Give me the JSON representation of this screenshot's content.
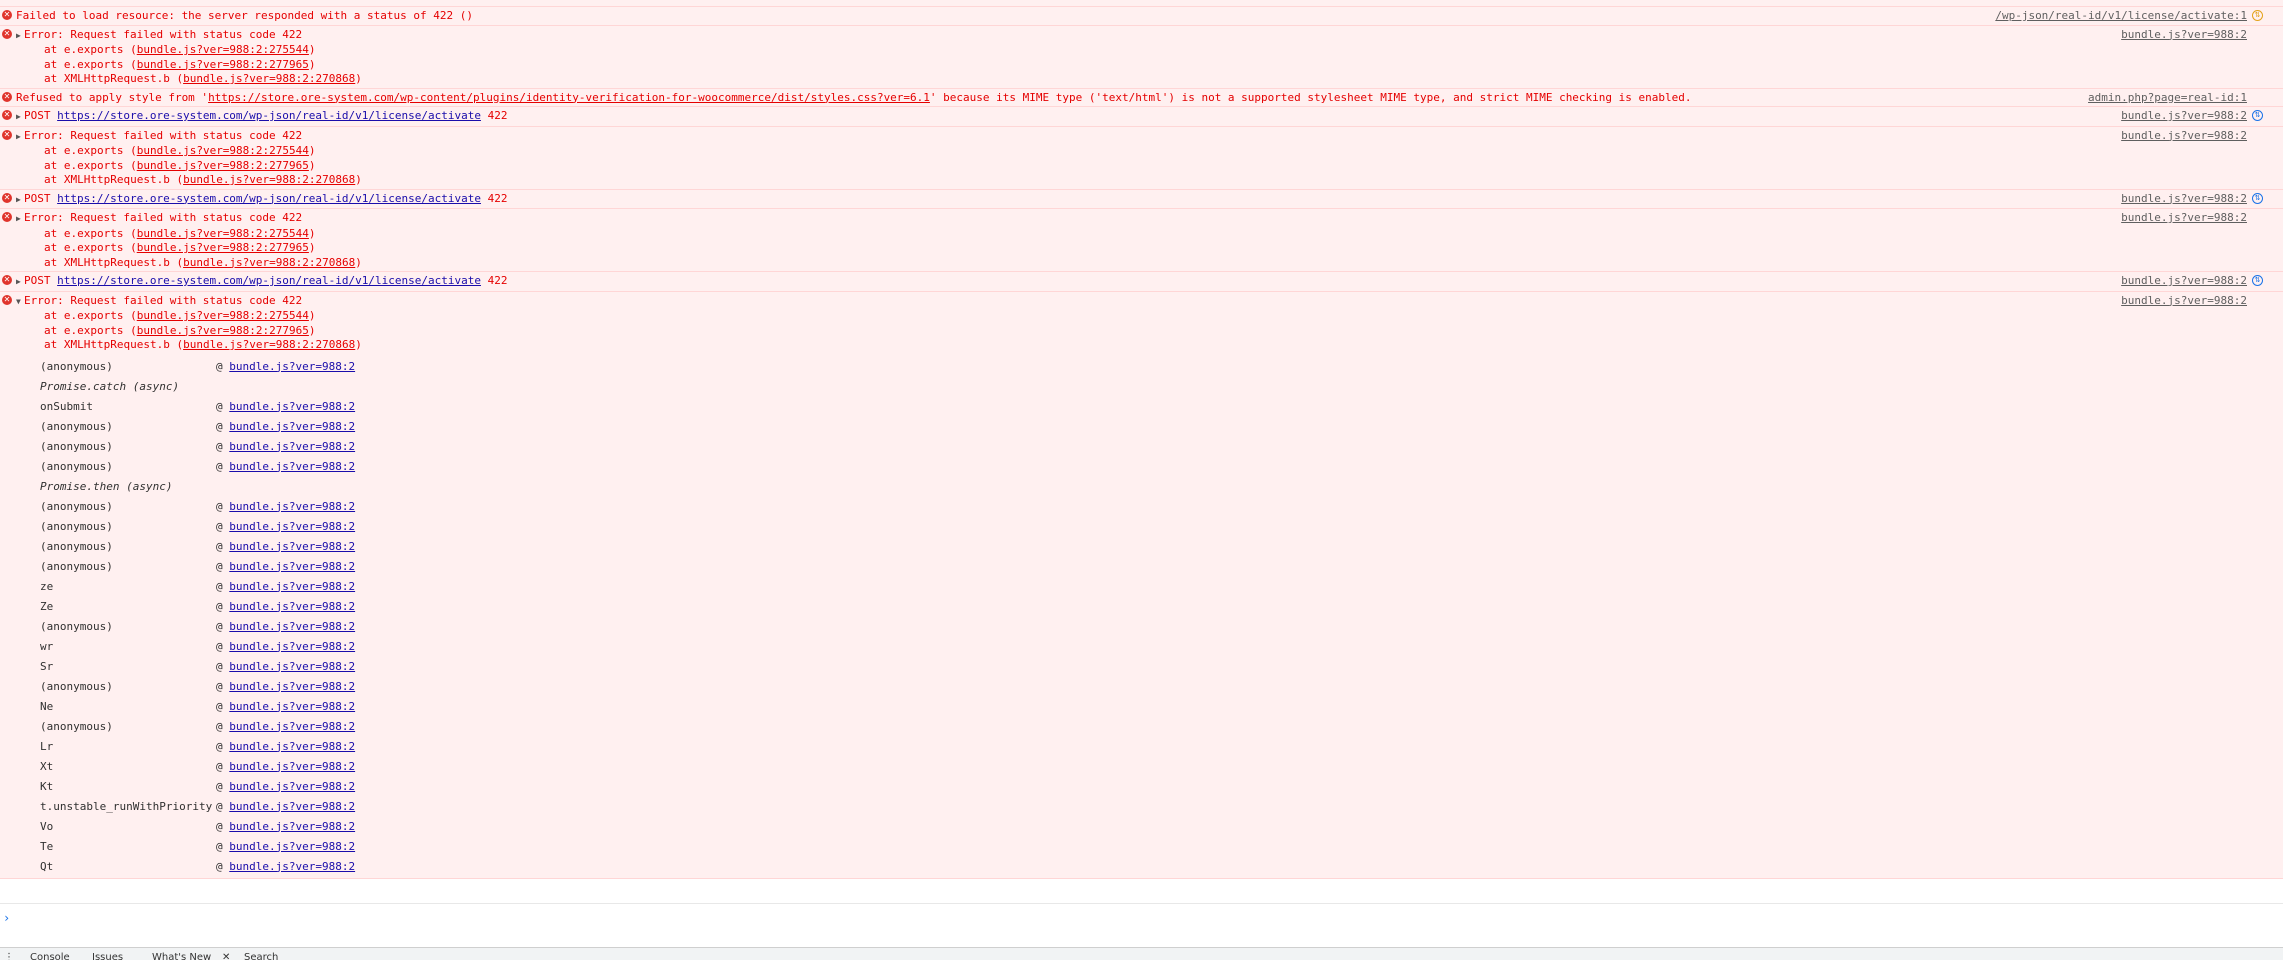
{
  "messages": [
    {
      "kind": "error",
      "text": "Failed to load resource: the server responded with a status of 422 ()",
      "source": "/wp-json/real-id/v1/license/activate:1",
      "network_icon": "warning"
    },
    {
      "kind": "stack",
      "text": "Error: Request failed with status code 422",
      "source": "bundle.js?ver=988:2",
      "frames": [
        {
          "prefix": "at e.exports (",
          "link": "bundle.js?ver=988:2:275544",
          "suffix": ")"
        },
        {
          "prefix": "at e.exports (",
          "link": "bundle.js?ver=988:2:277965",
          "suffix": ")"
        },
        {
          "prefix": "at XMLHttpRequest.b (",
          "link": "bundle.js?ver=988:2:270868",
          "suffix": ")"
        }
      ]
    },
    {
      "kind": "error",
      "text_before": "Refused to apply style from '",
      "url": "https://store.ore-system.com/wp-content/plugins/identity-verification-for-woocommerce/dist/styles.css?ver=6.1",
      "text_after": "' because its MIME type ('text/html') is not a supported stylesheet MIME type, and strict MIME checking is enabled.",
      "source": "admin.php?page=real-id:1"
    },
    {
      "kind": "post",
      "method": "POST",
      "url": "https://store.ore-system.com/wp-json/real-id/v1/license/activate",
      "code": "422",
      "source": "bundle.js?ver=988:2"
    },
    {
      "kind": "stack",
      "text": "Error: Request failed with status code 422",
      "source": "bundle.js?ver=988:2",
      "frames": [
        {
          "prefix": "at e.exports (",
          "link": "bundle.js?ver=988:2:275544",
          "suffix": ")"
        },
        {
          "prefix": "at e.exports (",
          "link": "bundle.js?ver=988:2:277965",
          "suffix": ")"
        },
        {
          "prefix": "at XMLHttpRequest.b (",
          "link": "bundle.js?ver=988:2:270868",
          "suffix": ")"
        }
      ]
    },
    {
      "kind": "post",
      "method": "POST",
      "url": "https://store.ore-system.com/wp-json/real-id/v1/license/activate",
      "code": "422",
      "source": "bundle.js?ver=988:2"
    },
    {
      "kind": "stack",
      "text": "Error: Request failed with status code 422",
      "source": "bundle.js?ver=988:2",
      "frames": [
        {
          "prefix": "at e.exports (",
          "link": "bundle.js?ver=988:2:275544",
          "suffix": ")"
        },
        {
          "prefix": "at e.exports (",
          "link": "bundle.js?ver=988:2:277965",
          "suffix": ")"
        },
        {
          "prefix": "at XMLHttpRequest.b (",
          "link": "bundle.js?ver=988:2:270868",
          "suffix": ")"
        }
      ]
    },
    {
      "kind": "post",
      "method": "POST",
      "url": "https://store.ore-system.com/wp-json/real-id/v1/license/activate",
      "code": "422",
      "source": "bundle.js?ver=988:2"
    }
  ],
  "expanded": {
    "text": "Error: Request failed with status code 422",
    "source": "bundle.js?ver=988:2",
    "frames": [
      {
        "prefix": "at e.exports (",
        "link": "bundle.js?ver=988:2:275544",
        "suffix": ")"
      },
      {
        "prefix": "at e.exports (",
        "link": "bundle.js?ver=988:2:277965",
        "suffix": ")"
      },
      {
        "prefix": "at XMLHttpRequest.b (",
        "link": "bundle.js?ver=988:2:270868",
        "suffix": ")"
      }
    ],
    "call_stack": [
      {
        "fn": "(anonymous)",
        "link": "bundle.js?ver=988:2"
      },
      {
        "fn": "Promise.catch (async)",
        "async": true
      },
      {
        "fn": "onSubmit",
        "link": "bundle.js?ver=988:2"
      },
      {
        "fn": "(anonymous)",
        "link": "bundle.js?ver=988:2"
      },
      {
        "fn": "(anonymous)",
        "link": "bundle.js?ver=988:2"
      },
      {
        "fn": "(anonymous)",
        "link": "bundle.js?ver=988:2"
      },
      {
        "fn": "Promise.then (async)",
        "async": true
      },
      {
        "fn": "(anonymous)",
        "link": "bundle.js?ver=988:2"
      },
      {
        "fn": "(anonymous)",
        "link": "bundle.js?ver=988:2"
      },
      {
        "fn": "(anonymous)",
        "link": "bundle.js?ver=988:2"
      },
      {
        "fn": "(anonymous)",
        "link": "bundle.js?ver=988:2"
      },
      {
        "fn": "ze",
        "link": "bundle.js?ver=988:2"
      },
      {
        "fn": "Ze",
        "link": "bundle.js?ver=988:2"
      },
      {
        "fn": "(anonymous)",
        "link": "bundle.js?ver=988:2"
      },
      {
        "fn": "wr",
        "link": "bundle.js?ver=988:2"
      },
      {
        "fn": "Sr",
        "link": "bundle.js?ver=988:2"
      },
      {
        "fn": "(anonymous)",
        "link": "bundle.js?ver=988:2"
      },
      {
        "fn": "Ne",
        "link": "bundle.js?ver=988:2"
      },
      {
        "fn": "(anonymous)",
        "link": "bundle.js?ver=988:2"
      },
      {
        "fn": "Lr",
        "link": "bundle.js?ver=988:2"
      },
      {
        "fn": "Xt",
        "link": "bundle.js?ver=988:2"
      },
      {
        "fn": "Kt",
        "link": "bundle.js?ver=988:2"
      },
      {
        "fn": "t.unstable_runWithPriority",
        "link": "bundle.js?ver=988:2"
      },
      {
        "fn": "Vo",
        "link": "bundle.js?ver=988:2"
      },
      {
        "fn": "Te",
        "link": "bundle.js?ver=988:2"
      },
      {
        "fn": "Qt",
        "link": "bundle.js?ver=988:2"
      }
    ]
  },
  "prompt": {
    "chevron": "›"
  },
  "drawer": {
    "tabs": [
      "Console",
      "Issues",
      "What's New",
      "Search"
    ]
  },
  "colors": {
    "error_bg": "#fff0f0",
    "error_text": "#e50000",
    "link": "#1a0dab"
  }
}
